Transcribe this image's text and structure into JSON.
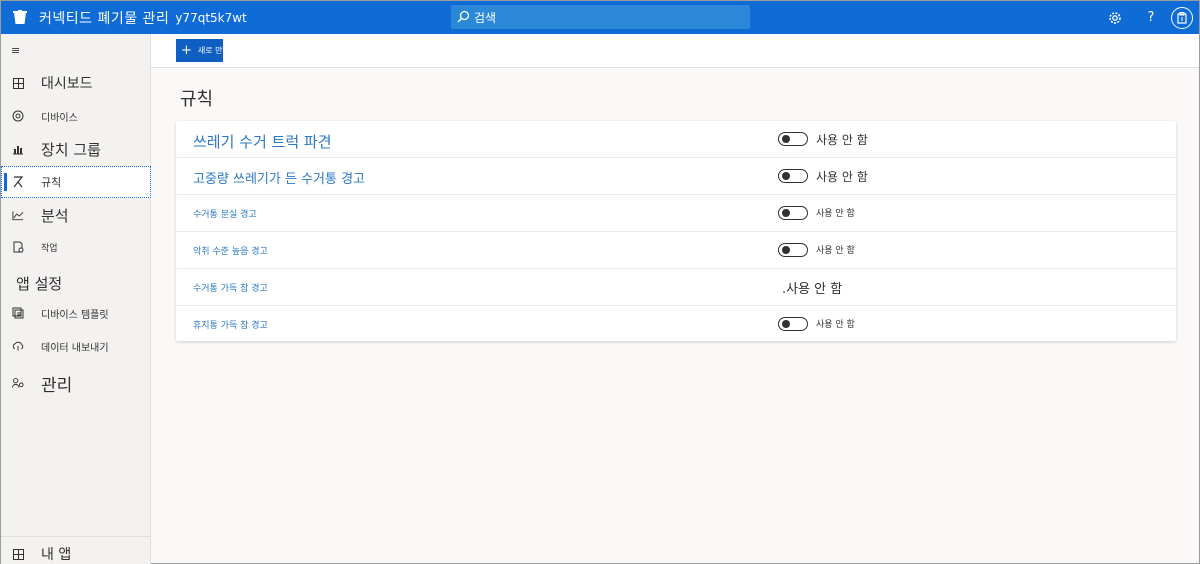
{
  "header": {
    "app_title": "커넥티드 폐기물 관리",
    "app_id": "y77qt5k7wt",
    "search_placeholder": "검색",
    "help_label": "?"
  },
  "sidebar": {
    "menu_label": "≡",
    "items": [
      {
        "label": "대시보드",
        "icon": "dashboard-icon"
      },
      {
        "label": "디바이스",
        "icon": "devices-icon"
      },
      {
        "label": "장치 그룹",
        "icon": "device-groups-icon"
      },
      {
        "label": "규칙",
        "icon": "rules-icon",
        "active": true
      },
      {
        "label": "분석",
        "icon": "analytics-icon"
      },
      {
        "label": "작업",
        "icon": "jobs-icon"
      }
    ],
    "app_settings_label": "앱 설정",
    "settings_items": [
      {
        "label": "디바이스 템플릿",
        "icon": "device-templates-icon"
      },
      {
        "label": "데이터 내보내기",
        "icon": "data-export-icon"
      },
      {
        "label": "관리",
        "icon": "administration-icon"
      }
    ],
    "my_apps_label": "내 앱"
  },
  "command_bar": {
    "new_button_label": "새로 만들기"
  },
  "main": {
    "title": "규칙",
    "rules": [
      {
        "name": "쓰레기 수거 트럭 파견",
        "status": "사용 안 함",
        "show_toggle": true
      },
      {
        "name": "고중량 쓰레기가 든 수거통 경고",
        "status": "사용 안 함",
        "show_toggle": true
      },
      {
        "name": "수거통 분실 경고",
        "status": "사용 안 함",
        "show_toggle": true
      },
      {
        "name": "악취 수준 높음 경고",
        "status": "사용 안 함",
        "show_toggle": true
      },
      {
        "name": "수거통 가득 참 경고",
        "status": ".사용 안 함",
        "show_toggle": false
      },
      {
        "name": "휴지통 가득 참 경고",
        "status": "사용 안 함",
        "show_toggle": true
      }
    ]
  },
  "colors": {
    "brand": "#0f6cd6",
    "link": "#2b78c5"
  }
}
